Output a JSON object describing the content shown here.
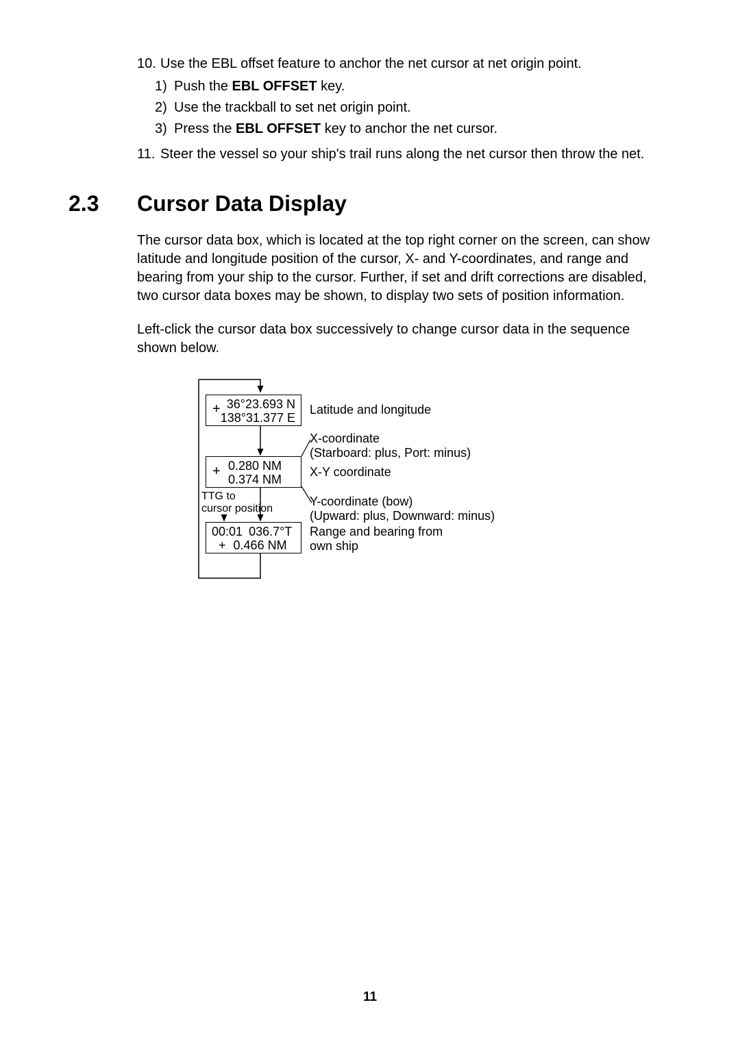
{
  "list": {
    "item10": {
      "num": "10.",
      "text": "Use the EBL offset feature to anchor the net cursor at net origin point."
    },
    "sub1": {
      "num": "1)",
      "part1": "Push the ",
      "bold": "EBL OFFSET",
      "part2": " key."
    },
    "sub2": {
      "num": "2)",
      "text": "Use the trackball to set net origin point."
    },
    "sub3": {
      "num": "3)",
      "part1": "Press the ",
      "bold": "EBL OFFSET",
      "part2": " key to anchor the net cursor."
    },
    "item11": {
      "num": "11.",
      "text": "Steer the vessel so your ship's trail runs along the net cursor then throw the net."
    }
  },
  "section": {
    "num": "2.3",
    "title": "Cursor Data Display",
    "para1": "The cursor data box, which is located at the top right corner on the screen, can show latitude and longitude position of the cursor, X- and Y-coordinates, and range and bearing from your ship to the cursor. Further, if set and drift corrections are disabled, two cursor data boxes may be shown, to display two sets of position information.",
    "para2": "Left-click the cursor data box successively to change cursor data in the sequence shown below."
  },
  "diagram": {
    "box1": {
      "plus": "+",
      "line1": "36°23.693 N",
      "line2": "138°31.377 E",
      "label": "Latitude and longitude"
    },
    "xcoord": {
      "line1": "X-coordinate",
      "line2": "(Starboard: plus, Port: minus)"
    },
    "box2": {
      "plus": "+",
      "line1": "0.280 NM",
      "line2": "0.374 NM",
      "label": "X-Y coordinate"
    },
    "ttg": {
      "line1": "TTG to",
      "line2": "cursor position"
    },
    "ycoord": {
      "line1": "Y-coordinate (bow)",
      "line2": "(Upward: plus, Downward: minus)"
    },
    "box3": {
      "ttg": "00:01",
      "brg": "036.7°T",
      "plus": "+",
      "rng": "0.466 NM",
      "label1": "Range and bearing from",
      "label2": "own ship"
    },
    "pagenum": "11"
  }
}
